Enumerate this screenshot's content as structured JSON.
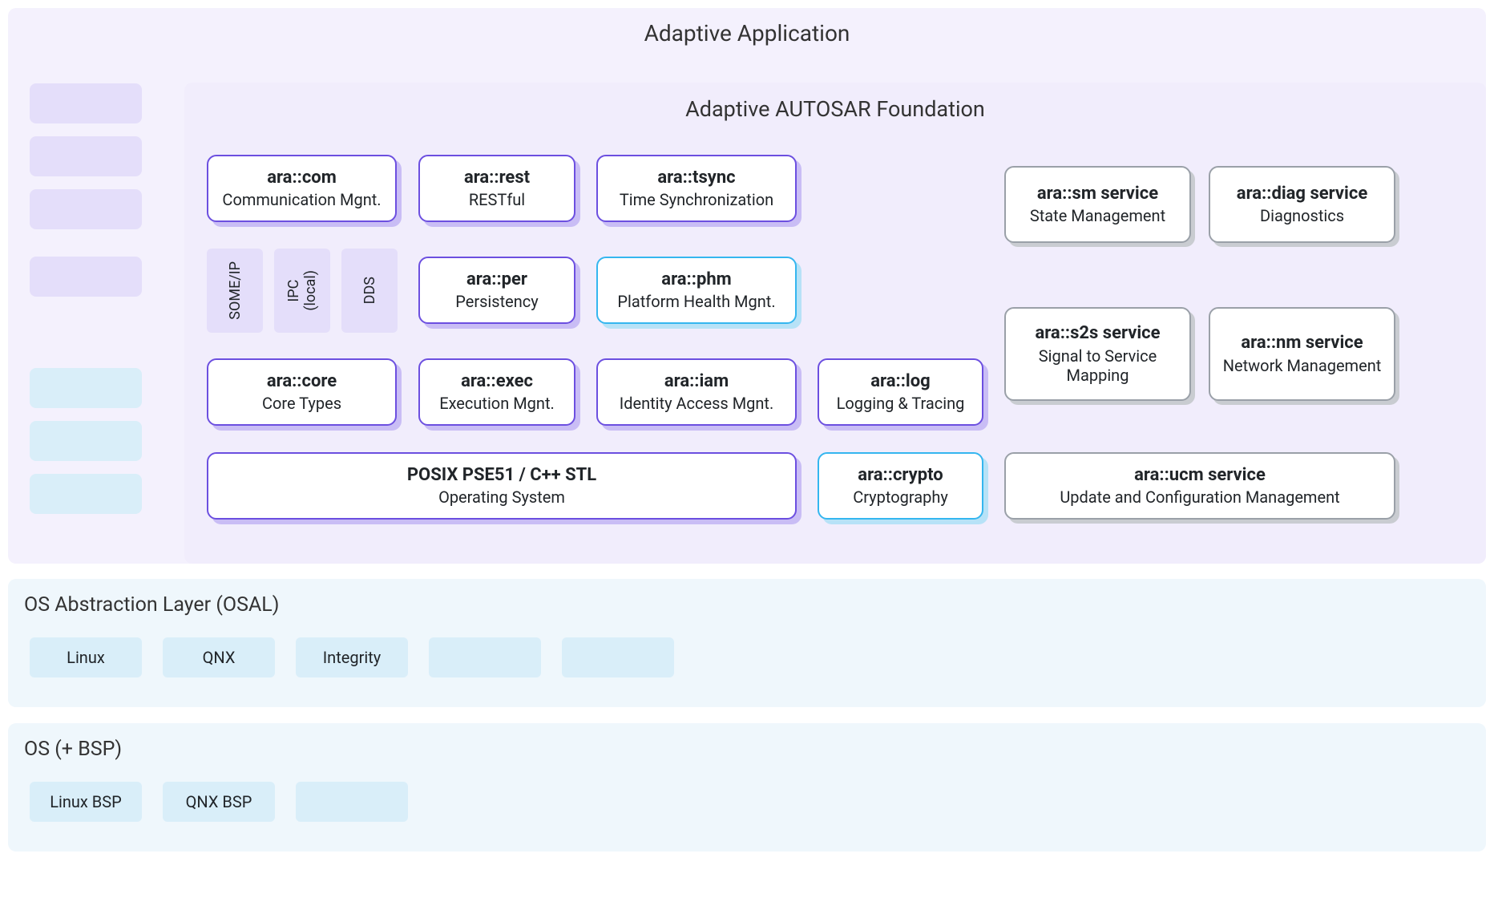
{
  "top": {
    "title": "Adaptive Application",
    "foundation_title": "Adaptive AUTOSAR Foundation",
    "ara_com": {
      "t": "ara::com",
      "s": "Communication Mgnt."
    },
    "ara_rest": {
      "t": "ara::rest",
      "s": "RESTful"
    },
    "ara_tsync": {
      "t": "ara::tsync",
      "s": "Time Synchronization"
    },
    "ara_per": {
      "t": "ara::per",
      "s": "Persistency"
    },
    "ara_phm": {
      "t": "ara::phm",
      "s": "Platform Health Mgnt."
    },
    "ara_core": {
      "t": "ara::core",
      "s": "Core Types"
    },
    "ara_exec": {
      "t": "ara::exec",
      "s": "Execution Mgnt."
    },
    "ara_iam": {
      "t": "ara::iam",
      "s": "Identity Access Mgnt."
    },
    "ara_log": {
      "t": "ara::log",
      "s": "Logging & Tracing"
    },
    "posix": {
      "t": "POSIX PSE51 / C++ STL",
      "s": "Operating System"
    },
    "ara_crypto": {
      "t": "ara::crypto",
      "s": "Cryptography"
    },
    "someip": "SOME/IP",
    "ipc": "IPC\n(local)",
    "dds": "DDS",
    "svc_sm": {
      "t": "ara::sm service",
      "s": "State Management"
    },
    "svc_diag": {
      "t": "ara::diag service",
      "s": "Diagnostics"
    },
    "svc_s2s": {
      "t": "ara::s2s service",
      "s": "Signal to Service Mapping"
    },
    "svc_nm": {
      "t": "ara::nm service",
      "s": "Network Management"
    },
    "svc_ucm": {
      "t": "ara::ucm service",
      "s": "Update and Configuration Management"
    }
  },
  "osal": {
    "title": "OS Abstraction Layer (OSAL)",
    "items": [
      "Linux",
      "QNX",
      "Integrity",
      "",
      ""
    ]
  },
  "osbsp": {
    "title": "OS (+ BSP)",
    "items": [
      "Linux BSP",
      "QNX BSP",
      ""
    ]
  }
}
